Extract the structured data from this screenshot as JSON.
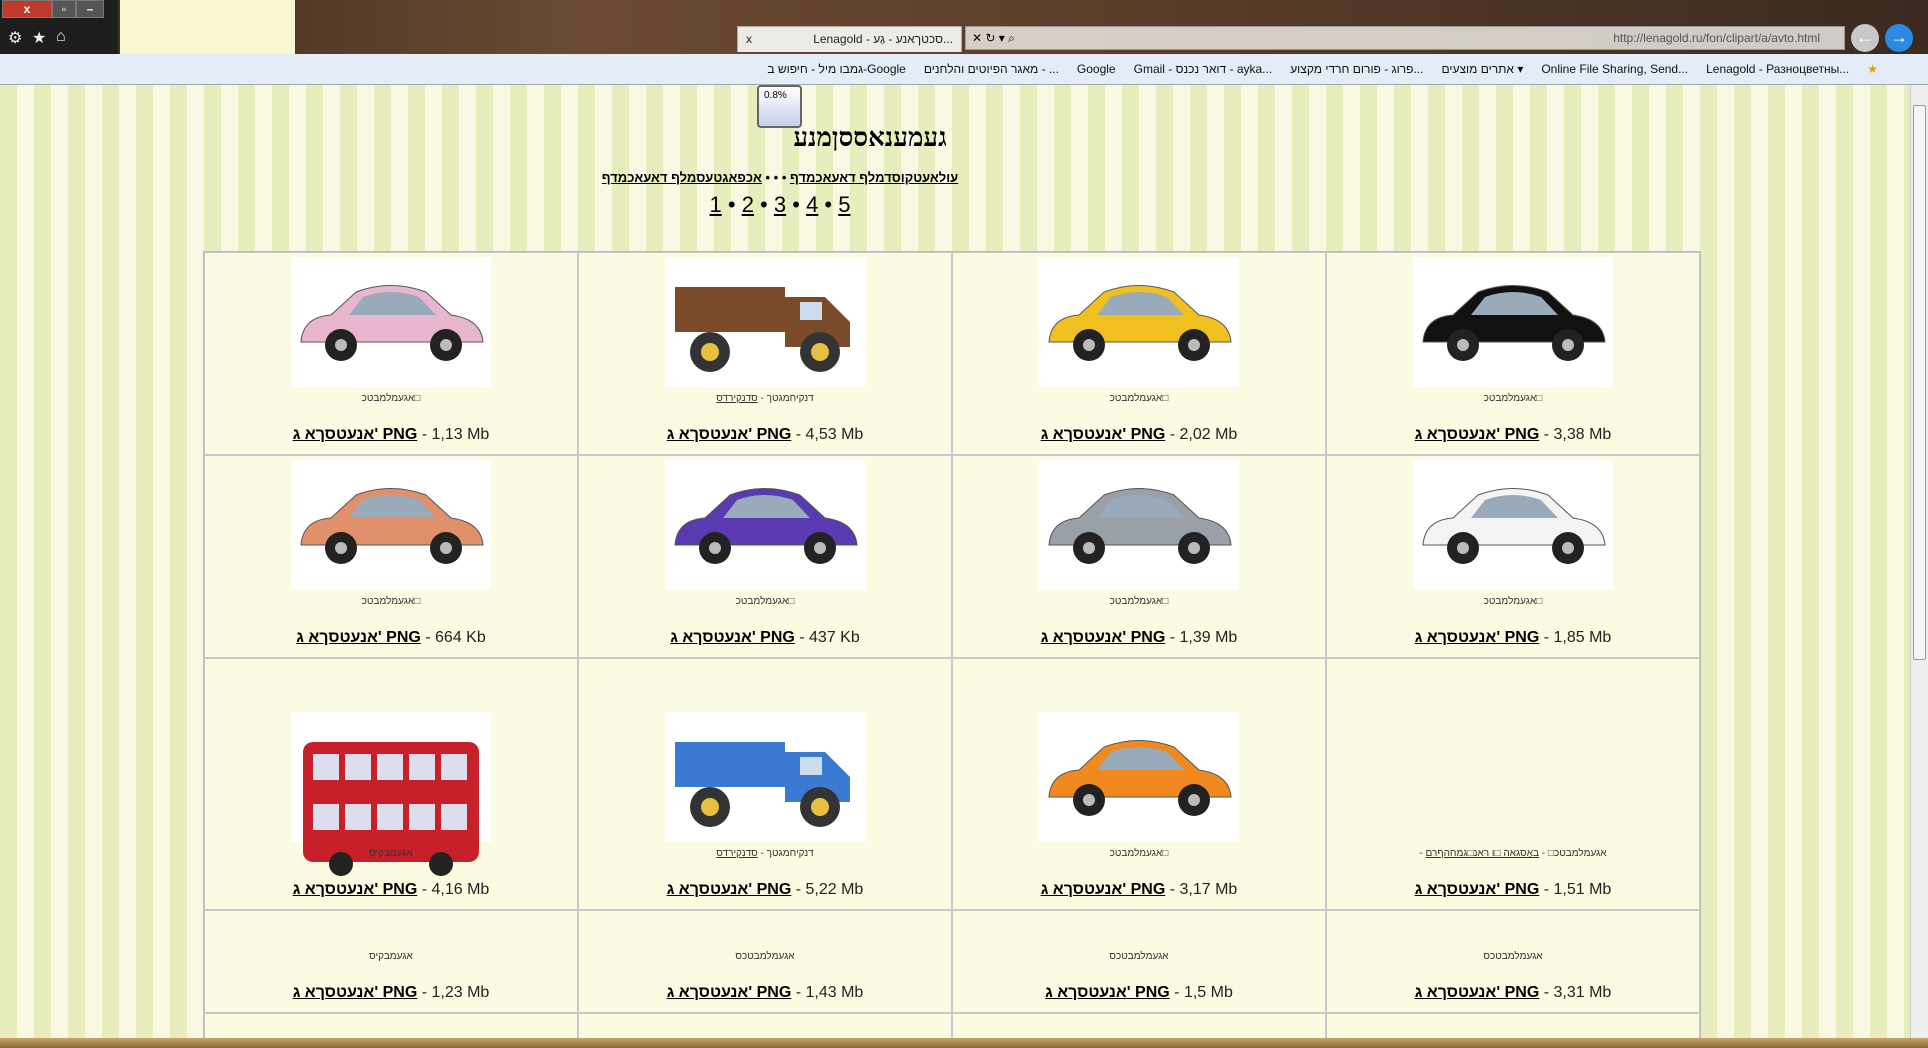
{
  "window": {
    "close": "x",
    "restore": "▫",
    "minimize": "–"
  },
  "toolbar_icons": [
    "gear-icon",
    "star-icon",
    "home-icon"
  ],
  "tab": {
    "title": "Lenagold - סכטךאנע - גַע...",
    "close": "x"
  },
  "address": {
    "url": "http://lenagold.ru/fon/clipart/a/avto.html"
  },
  "bookmarks": [
    "Lenagold - Разноцветны...",
    "Online File Sharing, Send...",
    "אתרים מוצעים ▾",
    "פרוג - פורום חרדי מקצוע...",
    "Gmail - דואר נכנס - ayka...",
    "Google",
    "מאגר הפיוטים והלחנים - ...",
    "גמבו מיל - חיפוש ב-Google"
  ],
  "zoom_badge": "0.8%",
  "page": {
    "title": "געמענאססןמנע",
    "link_left": "עולאעטקוסדמלף דאעאכמדף",
    "link_sep": " • • • ",
    "link_right": "אכפאגטעסמלף דאעאכמדף",
    "pages": [
      "1",
      "2",
      "3",
      "4",
      "5"
    ],
    "page_sep": " • "
  },
  "download_label": "אנעטסךא ג' PNG",
  "cells": [
    {
      "img": "car",
      "color": "#e8b6cf",
      "cap": "אגעמלמבטכ□",
      "cap_link": "",
      "size": " - 1,13 Mb"
    },
    {
      "img": "truck",
      "color": "#7a4a2a",
      "cap": "דנקיחמגטך - ",
      "cap_link": "סדנקירדס",
      "size": " - 4,53 Mb"
    },
    {
      "img": "car",
      "color": "#f0c020",
      "cap": "אגעמלמבטכ□",
      "cap_link": "",
      "size": " - 2,02 Mb"
    },
    {
      "img": "car",
      "color": "#111111",
      "cap": "אגעמלמבטכ□",
      "cap_link": "",
      "size": " - 3,38 Mb"
    },
    {
      "img": "car",
      "color": "#e0906a",
      "cap": "אגעמלמבטכ□",
      "cap_link": "",
      "size": " - 664 Kb"
    },
    {
      "img": "car",
      "color": "#5a3ab0",
      "cap": "אגעמלמבטכ□",
      "cap_link": "",
      "size": " - 437 Kb"
    },
    {
      "img": "car",
      "color": "#9aa0a8",
      "cap": "אגעמלמבטכ□",
      "cap_link": "",
      "size": " - 1,39 Mb"
    },
    {
      "img": "car",
      "color": "#f4f4f4",
      "cap": "אגעמלמבטכ□",
      "cap_link": "",
      "size": " - 1,85 Mb"
    },
    {
      "img": "bus",
      "color": "#c8202a",
      "cap": "אגעמבקיס",
      "cap_link": "",
      "size": " - 4,16 Mb"
    },
    {
      "img": "truck",
      "color": "#3a7ad0",
      "cap": "דנקיחמגטך - ",
      "cap_link": "סדנקירדס",
      "size": " - 5,22 Mb"
    },
    {
      "img": "car",
      "color": "#f08a20",
      "cap": "אגעמלמבטכ□",
      "cap_link": "",
      "size": " - 3,17 Mb"
    },
    {
      "img": "",
      "color": "",
      "cap": "- אגעמלמבטכ□ - ",
      "cap_link": "באַסגאה □ו ראנ□גמחהףרם",
      "size": " - 1,51 Mb"
    },
    {
      "img": "",
      "color": "",
      "cap": "אגעמבקיס",
      "cap_link": "",
      "size": " - 1,23 Mb"
    },
    {
      "img": "",
      "color": "",
      "cap": "אגעמלמבטכס",
      "cap_link": "",
      "size": " - 1,43 Mb"
    },
    {
      "img": "",
      "color": "",
      "cap": "אגעמלמבטכס",
      "cap_link": "",
      "size": " - 1,5 Mb"
    },
    {
      "img": "",
      "color": "",
      "cap": "אגעמלמבטכס",
      "cap_link": "",
      "size": " - 3,31 Mb"
    }
  ]
}
